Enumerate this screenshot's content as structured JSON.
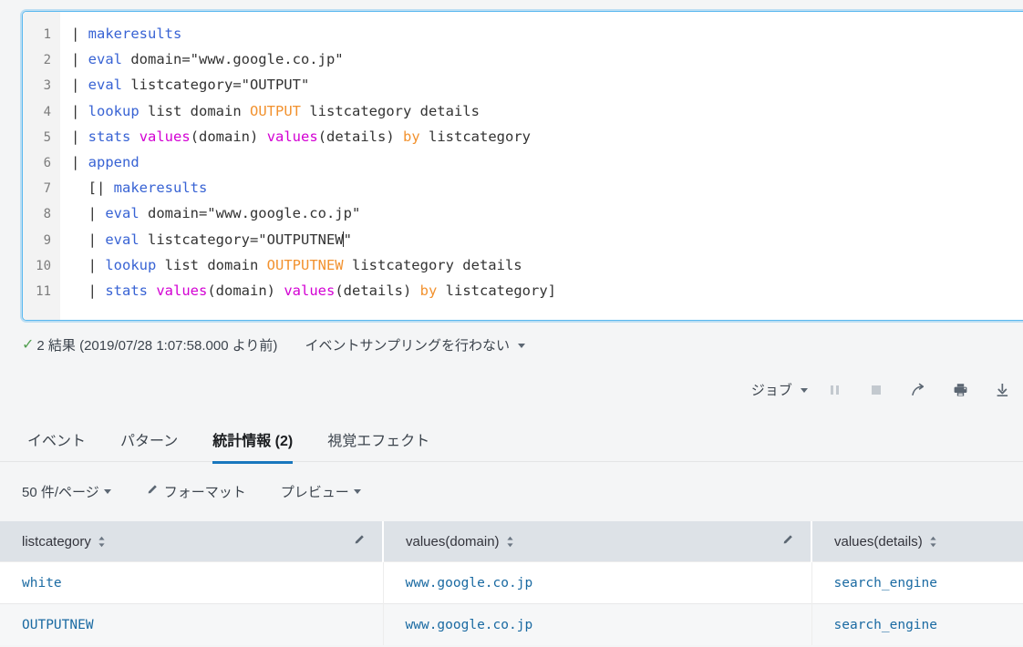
{
  "editor": {
    "name": "spl-search-editor",
    "lines": [
      {
        "n": "1",
        "segments": [
          {
            "t": "| ",
            "c": "plain"
          },
          {
            "t": "makeresults",
            "c": "cmd"
          }
        ]
      },
      {
        "n": "2",
        "segments": [
          {
            "t": "| ",
            "c": "plain"
          },
          {
            "t": "eval",
            "c": "cmd"
          },
          {
            "t": " domain=\"www.google.co.jp\"",
            "c": "plain"
          }
        ]
      },
      {
        "n": "3",
        "segments": [
          {
            "t": "| ",
            "c": "plain"
          },
          {
            "t": "eval",
            "c": "cmd"
          },
          {
            "t": " listcategory=\"OUTPUT\"",
            "c": "plain"
          }
        ]
      },
      {
        "n": "4",
        "segments": [
          {
            "t": "| ",
            "c": "plain"
          },
          {
            "t": "lookup",
            "c": "cmd"
          },
          {
            "t": " list domain ",
            "c": "plain"
          },
          {
            "t": "OUTPUT",
            "c": "kw"
          },
          {
            "t": " listcategory details",
            "c": "plain"
          }
        ]
      },
      {
        "n": "5",
        "segments": [
          {
            "t": "| ",
            "c": "plain"
          },
          {
            "t": "stats",
            "c": "cmd"
          },
          {
            "t": " ",
            "c": "plain"
          },
          {
            "t": "values",
            "c": "fn"
          },
          {
            "t": "(domain) ",
            "c": "plain"
          },
          {
            "t": "values",
            "c": "fn"
          },
          {
            "t": "(details) ",
            "c": "plain"
          },
          {
            "t": "by",
            "c": "kw"
          },
          {
            "t": " listcategory",
            "c": "plain"
          }
        ]
      },
      {
        "n": "6",
        "segments": [
          {
            "t": "| ",
            "c": "plain"
          },
          {
            "t": "append",
            "c": "cmd"
          }
        ]
      },
      {
        "n": "7",
        "segments": [
          {
            "t": "  [| ",
            "c": "plain"
          },
          {
            "t": "makeresults",
            "c": "cmd"
          }
        ]
      },
      {
        "n": "8",
        "segments": [
          {
            "t": "  | ",
            "c": "plain"
          },
          {
            "t": "eval",
            "c": "cmd"
          },
          {
            "t": " domain=\"www.google.co.jp\"",
            "c": "plain"
          }
        ]
      },
      {
        "n": "9",
        "segments": [
          {
            "t": "  | ",
            "c": "plain"
          },
          {
            "t": "eval",
            "c": "cmd"
          },
          {
            "t": " listcategory=\"OUTPUTNEW",
            "c": "plain"
          },
          {
            "t": "CARET",
            "c": "caret"
          },
          {
            "t": "\"",
            "c": "plain"
          }
        ]
      },
      {
        "n": "10",
        "segments": [
          {
            "t": "  | ",
            "c": "plain"
          },
          {
            "t": "lookup",
            "c": "cmd"
          },
          {
            "t": " list domain ",
            "c": "plain"
          },
          {
            "t": "OUTPUTNEW",
            "c": "kw"
          },
          {
            "t": " listcategory details",
            "c": "plain"
          }
        ]
      },
      {
        "n": "11",
        "segments": [
          {
            "t": "  | ",
            "c": "plain"
          },
          {
            "t": "stats",
            "c": "cmd"
          },
          {
            "t": " ",
            "c": "plain"
          },
          {
            "t": "values",
            "c": "fn"
          },
          {
            "t": "(domain) ",
            "c": "plain"
          },
          {
            "t": "values",
            "c": "fn"
          },
          {
            "t": "(details) ",
            "c": "plain"
          },
          {
            "t": "by",
            "c": "kw"
          },
          {
            "t": " listcategory]",
            "c": "plain"
          }
        ]
      }
    ]
  },
  "result_bar": {
    "check_icon": "check-icon",
    "count_text": "2 結果 (2019/07/28 1:07:58.000 より前)",
    "sampling_label": "イベントサンプリングを行わない"
  },
  "job_toolbar": {
    "job_label": "ジョブ",
    "icons": [
      {
        "name": "pause-icon",
        "disabled": true
      },
      {
        "name": "stop-icon",
        "disabled": true
      },
      {
        "name": "share-icon",
        "disabled": false
      },
      {
        "name": "print-icon",
        "disabled": false
      },
      {
        "name": "download-icon",
        "disabled": false
      }
    ]
  },
  "tabs": [
    {
      "label": "イベント",
      "name": "tab-events",
      "active": false
    },
    {
      "label": "パターン",
      "name": "tab-patterns",
      "active": false
    },
    {
      "label": "統計情報 (2)",
      "name": "tab-statistics",
      "active": true
    },
    {
      "label": "視覚エフェクト",
      "name": "tab-visualization",
      "active": false
    }
  ],
  "table_toolbar": {
    "per_page_label": "50 件/ページ",
    "format_label": "フォーマット",
    "preview_label": "プレビュー"
  },
  "table": {
    "columns": [
      {
        "label": "listcategory",
        "sortable": true,
        "editable": true
      },
      {
        "label": "values(domain)",
        "sortable": true,
        "editable": true
      },
      {
        "label": "values(details)",
        "sortable": true,
        "editable": false
      }
    ],
    "rows": [
      [
        "white",
        "www.google.co.jp",
        "search_engine"
      ],
      [
        "OUTPUTNEW",
        "www.google.co.jp",
        "search_engine"
      ]
    ]
  },
  "colors": {
    "focus_border": "#5ab8ef",
    "tab_active_underline": "#1877bd",
    "link_blue": "#1a6aa2",
    "success_green": "#53a051",
    "spl_command": "#3863d4",
    "spl_function": "#d300d3",
    "spl_keyword": "#f2922f",
    "table_header_bg": "#dde2e7"
  }
}
